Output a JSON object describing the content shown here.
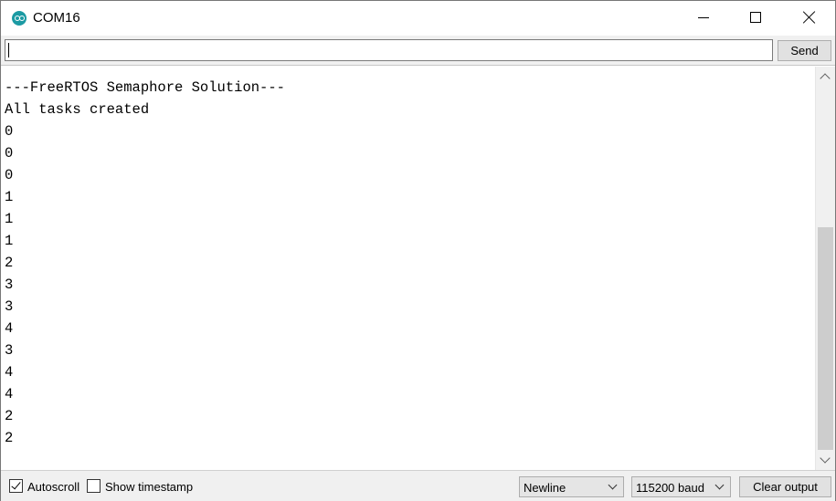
{
  "window": {
    "title": "COM16",
    "icon": "arduino-icon"
  },
  "input": {
    "value": "",
    "send_label": "Send"
  },
  "output": {
    "lines": [
      "---FreeRTOS Semaphore Solution---",
      "All tasks created",
      "0",
      "0",
      "0",
      "1",
      "1",
      "1",
      "2",
      "3",
      "3",
      "4",
      "3",
      "4",
      "4",
      "2",
      "2"
    ]
  },
  "bottom": {
    "autoscroll_label": "Autoscroll",
    "autoscroll_checked": true,
    "timestamp_label": "Show timestamp",
    "timestamp_checked": false,
    "line_ending": "Newline",
    "baud_rate": "115200 baud",
    "clear_label": "Clear output"
  },
  "colors": {
    "icon_teal": "#1b9aa3",
    "chrome_bg": "#f0f0f0",
    "button_bg": "#e1e1e1"
  }
}
